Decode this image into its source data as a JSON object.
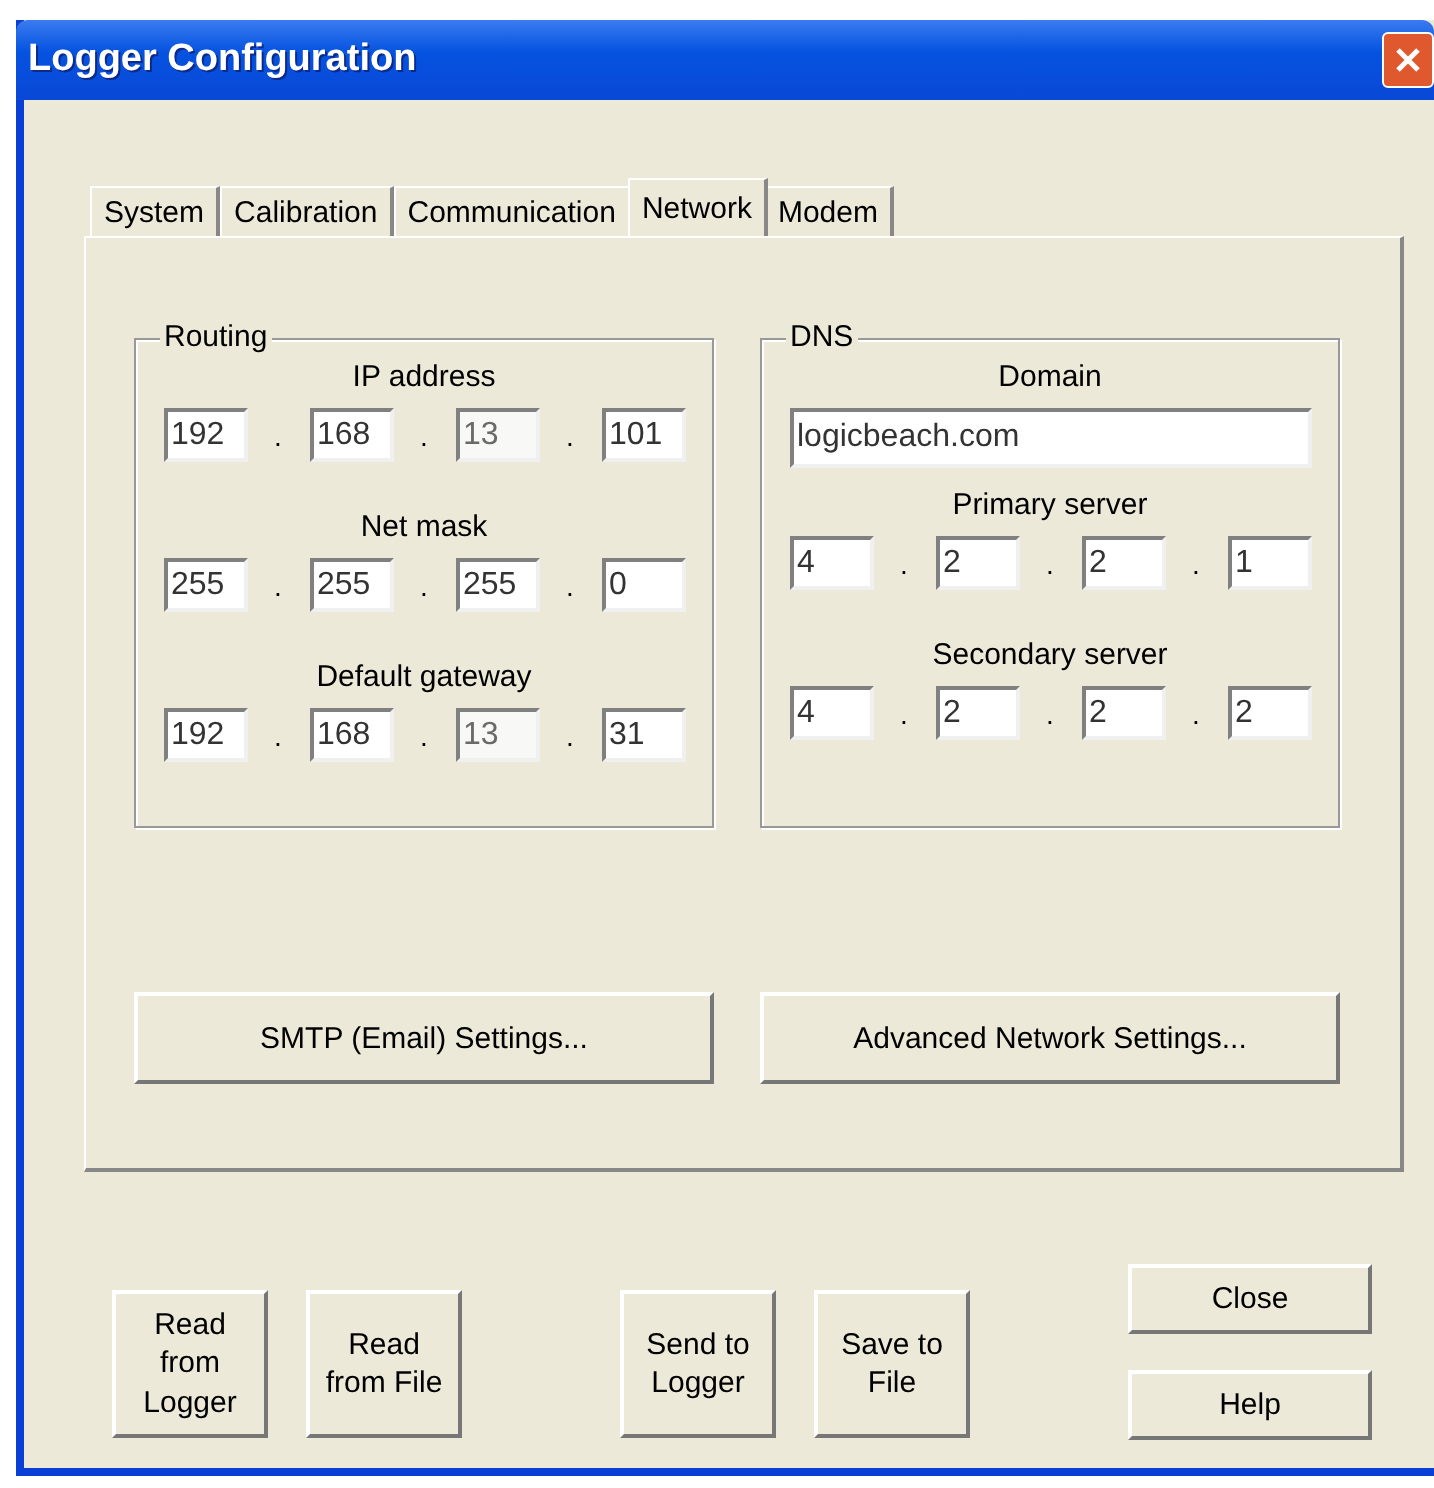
{
  "window": {
    "title": "Logger Configuration"
  },
  "tabs": [
    {
      "label": "System",
      "selected": false
    },
    {
      "label": "Calibration",
      "selected": false
    },
    {
      "label": "Communication",
      "selected": false
    },
    {
      "label": "Network",
      "selected": true
    },
    {
      "label": "Modem",
      "selected": false
    }
  ],
  "separator": ".",
  "routing": {
    "title": "Routing",
    "addresses": [
      {
        "label": "IP address",
        "octets": [
          {
            "value": "192",
            "disabled": false
          },
          {
            "value": "168",
            "disabled": false
          },
          {
            "value": "13",
            "disabled": true
          },
          {
            "value": "101",
            "disabled": false
          }
        ]
      },
      {
        "label": "Net mask",
        "octets": [
          {
            "value": "255",
            "disabled": false
          },
          {
            "value": "255",
            "disabled": false
          },
          {
            "value": "255",
            "disabled": false
          },
          {
            "value": "0",
            "disabled": false
          }
        ]
      },
      {
        "label": "Default gateway",
        "octets": [
          {
            "value": "192",
            "disabled": false
          },
          {
            "value": "168",
            "disabled": false
          },
          {
            "value": "13",
            "disabled": true
          },
          {
            "value": "31",
            "disabled": false
          }
        ]
      }
    ]
  },
  "dns": {
    "title": "DNS",
    "domain_label": "Domain",
    "domain": "logicbeach.com",
    "servers": [
      {
        "label": "Primary server",
        "octets": [
          {
            "value": "4",
            "disabled": false
          },
          {
            "value": "2",
            "disabled": false
          },
          {
            "value": "2",
            "disabled": false
          },
          {
            "value": "1",
            "disabled": false
          }
        ]
      },
      {
        "label": "Secondary server",
        "octets": [
          {
            "value": "4",
            "disabled": false
          },
          {
            "value": "2",
            "disabled": false
          },
          {
            "value": "2",
            "disabled": false
          },
          {
            "value": "2",
            "disabled": false
          }
        ]
      }
    ]
  },
  "panel_buttons": [
    "SMTP (Email) Settings...",
    "Advanced Network Settings..."
  ],
  "buttons": [
    {
      "lines": [
        "Read",
        "from",
        "Logger"
      ]
    },
    {
      "lines": [
        "Read",
        "from File"
      ]
    },
    {
      "lines": [
        "Send to",
        "Logger"
      ]
    },
    {
      "lines": [
        "Save to",
        "File"
      ]
    }
  ],
  "side_buttons": [
    "Close",
    "Help"
  ]
}
